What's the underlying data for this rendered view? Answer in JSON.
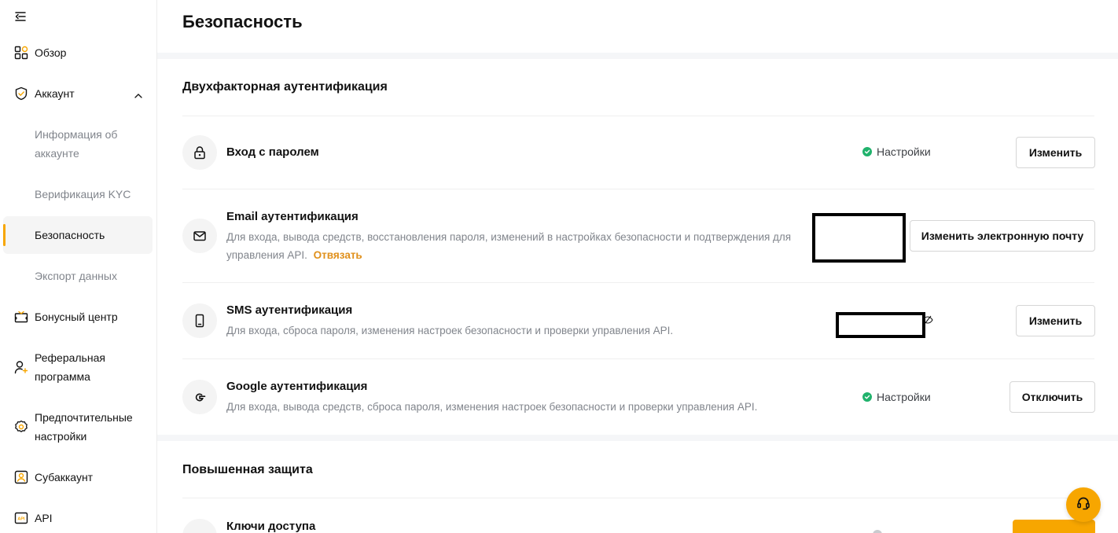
{
  "sidebar": {
    "items": [
      {
        "label": "Обзор",
        "icon": "grid-icon"
      },
      {
        "label": "Аккаунт",
        "icon": "shield-icon"
      },
      {
        "label": "Информация об аккаунте"
      },
      {
        "label": "Верификация KYC"
      },
      {
        "label": "Безопасность"
      },
      {
        "label": "Экспорт данных"
      },
      {
        "label": "Бонусный центр",
        "icon": "gift-icon"
      },
      {
        "label": "Реферальная программа",
        "icon": "user-plus-icon"
      },
      {
        "label": "Предпочтительные настройки",
        "icon": "gear-icon"
      },
      {
        "label": "Субаккаунт",
        "icon": "user-icon"
      },
      {
        "label": "API",
        "icon": "api-icon"
      }
    ]
  },
  "main": {
    "title": "Безопасность",
    "two_factor": {
      "title": "Двухфакторная аутентификация",
      "rows": [
        {
          "title": "Вход с паролем",
          "status": "Настройки",
          "button": "Изменить"
        },
        {
          "title": "Email аутентификация",
          "desc": "Для входа, вывода средств, восстановления пароля, изменений в настройках безопасности и подтверждения для управления API.",
          "link": "Отвязать",
          "button": "Изменить электронную почту"
        },
        {
          "title": "SMS аутентификация",
          "desc": "Для входа, сброса пароля, изменения настроек безопасности и проверки управления API.",
          "button": "Изменить"
        },
        {
          "title": "Google аутентификация",
          "desc": "Для входа, вывода средств, сброса пароля, изменения настроек безопасности и проверки управления API.",
          "status": "Настройки",
          "button": "Отключить"
        }
      ]
    },
    "advanced": {
      "title": "Повышенная защита",
      "rows": [
        {
          "title": "Ключи доступа"
        }
      ]
    }
  },
  "colors": {
    "accent": "#f7a600",
    "status_ok": "#20b26c",
    "link": "#e0901b",
    "muted_text": "#81858c"
  }
}
